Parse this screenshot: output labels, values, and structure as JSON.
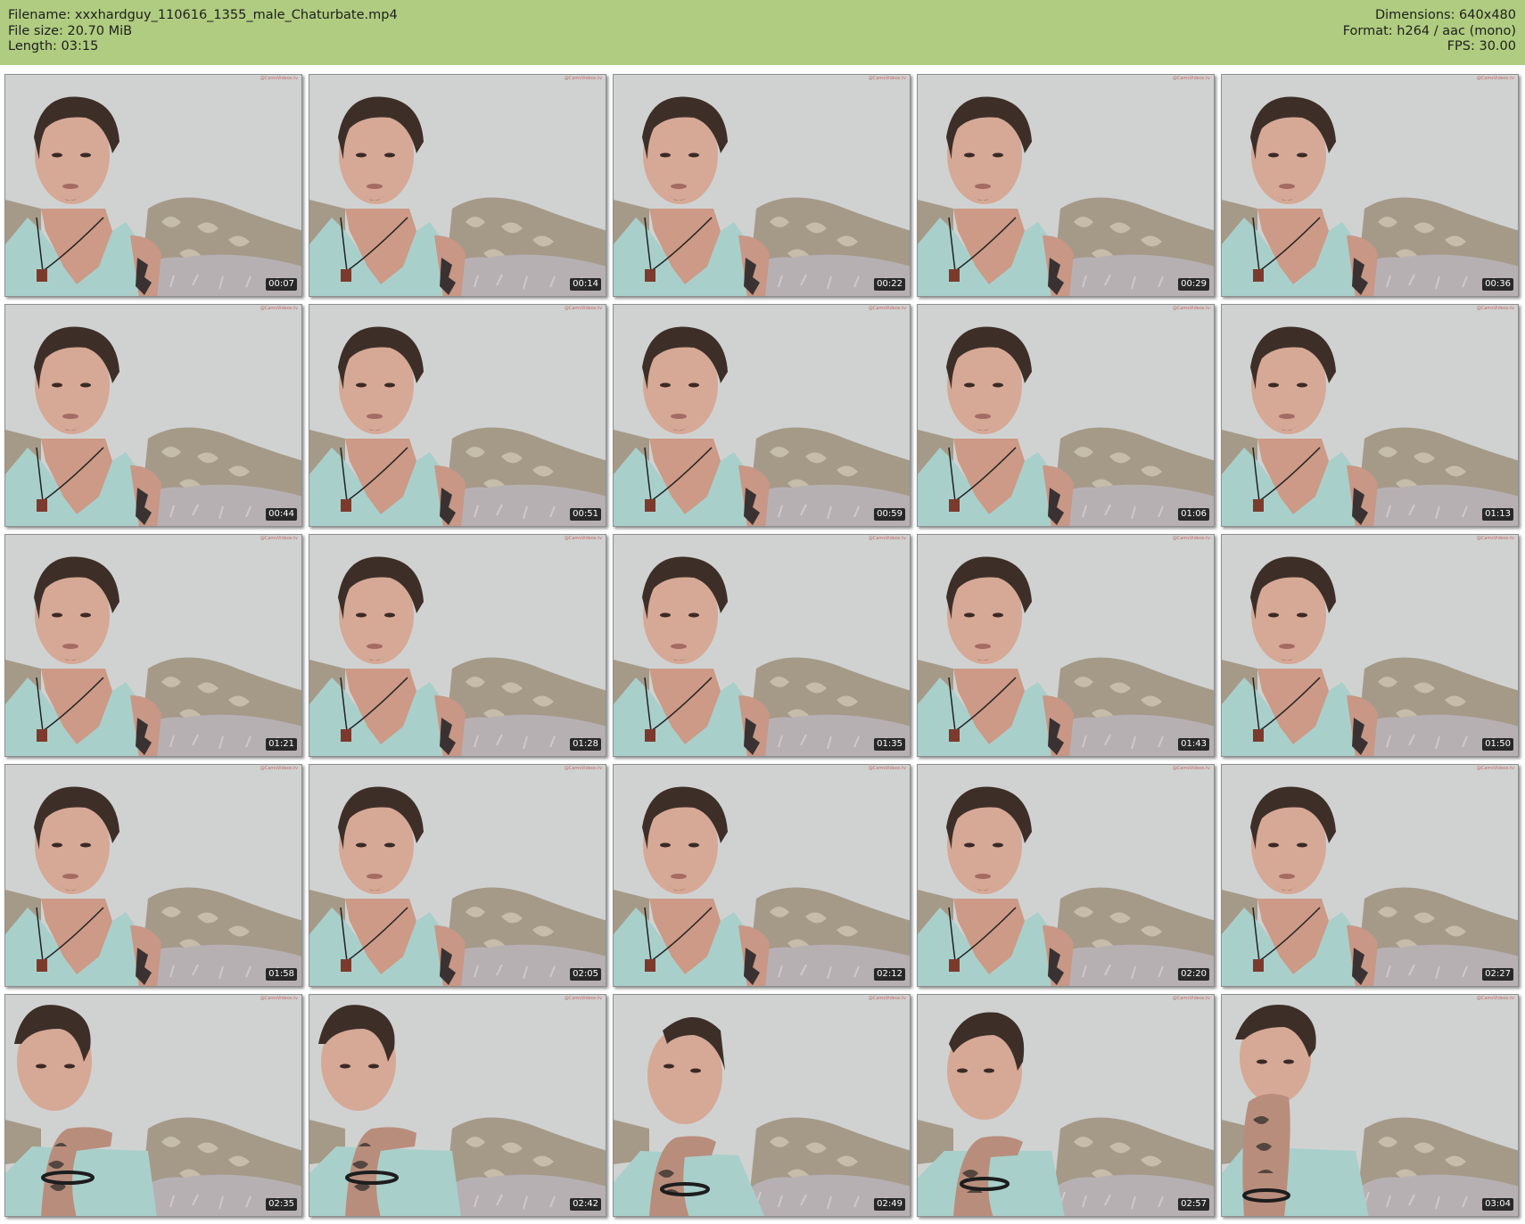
{
  "header": {
    "filename": "Filename: xxxhardguy_110616_1355_male_Chaturbate.mp4",
    "filesize": "File size: 20.70 MiB",
    "length": "Length: 03:15",
    "dimensions": "Dimensions: 640x480",
    "format": "Format: h264 / aac (mono)",
    "fps": "FPS: 30.00",
    "background_color": "#b0cc80"
  },
  "thumbnails": [
    {
      "timestamp": "00:07",
      "pose": "neutral"
    },
    {
      "timestamp": "00:14",
      "pose": "neutral"
    },
    {
      "timestamp": "00:22",
      "pose": "neutral"
    },
    {
      "timestamp": "00:29",
      "pose": "neutral"
    },
    {
      "timestamp": "00:36",
      "pose": "neutral"
    },
    {
      "timestamp": "00:44",
      "pose": "neutral"
    },
    {
      "timestamp": "00:51",
      "pose": "neutral"
    },
    {
      "timestamp": "00:59",
      "pose": "neutral"
    },
    {
      "timestamp": "01:06",
      "pose": "neutral"
    },
    {
      "timestamp": "01:13",
      "pose": "neutral"
    },
    {
      "timestamp": "01:21",
      "pose": "neutral"
    },
    {
      "timestamp": "01:28",
      "pose": "neutral"
    },
    {
      "timestamp": "01:35",
      "pose": "neutral"
    },
    {
      "timestamp": "01:43",
      "pose": "neutral"
    },
    {
      "timestamp": "01:50",
      "pose": "neutral"
    },
    {
      "timestamp": "01:58",
      "pose": "neutral"
    },
    {
      "timestamp": "02:05",
      "pose": "neutral"
    },
    {
      "timestamp": "02:12",
      "pose": "neutral"
    },
    {
      "timestamp": "02:20",
      "pose": "neutral"
    },
    {
      "timestamp": "02:27",
      "pose": "neutral"
    },
    {
      "timestamp": "02:35",
      "pose": "arm-raised"
    },
    {
      "timestamp": "02:42",
      "pose": "arm-raised"
    },
    {
      "timestamp": "02:49",
      "pose": "looking-up"
    },
    {
      "timestamp": "02:57",
      "pose": "looking-side"
    },
    {
      "timestamp": "03:04",
      "pose": "hand-on-chin"
    }
  ],
  "watermark_text": "@CamsVideos.tv"
}
